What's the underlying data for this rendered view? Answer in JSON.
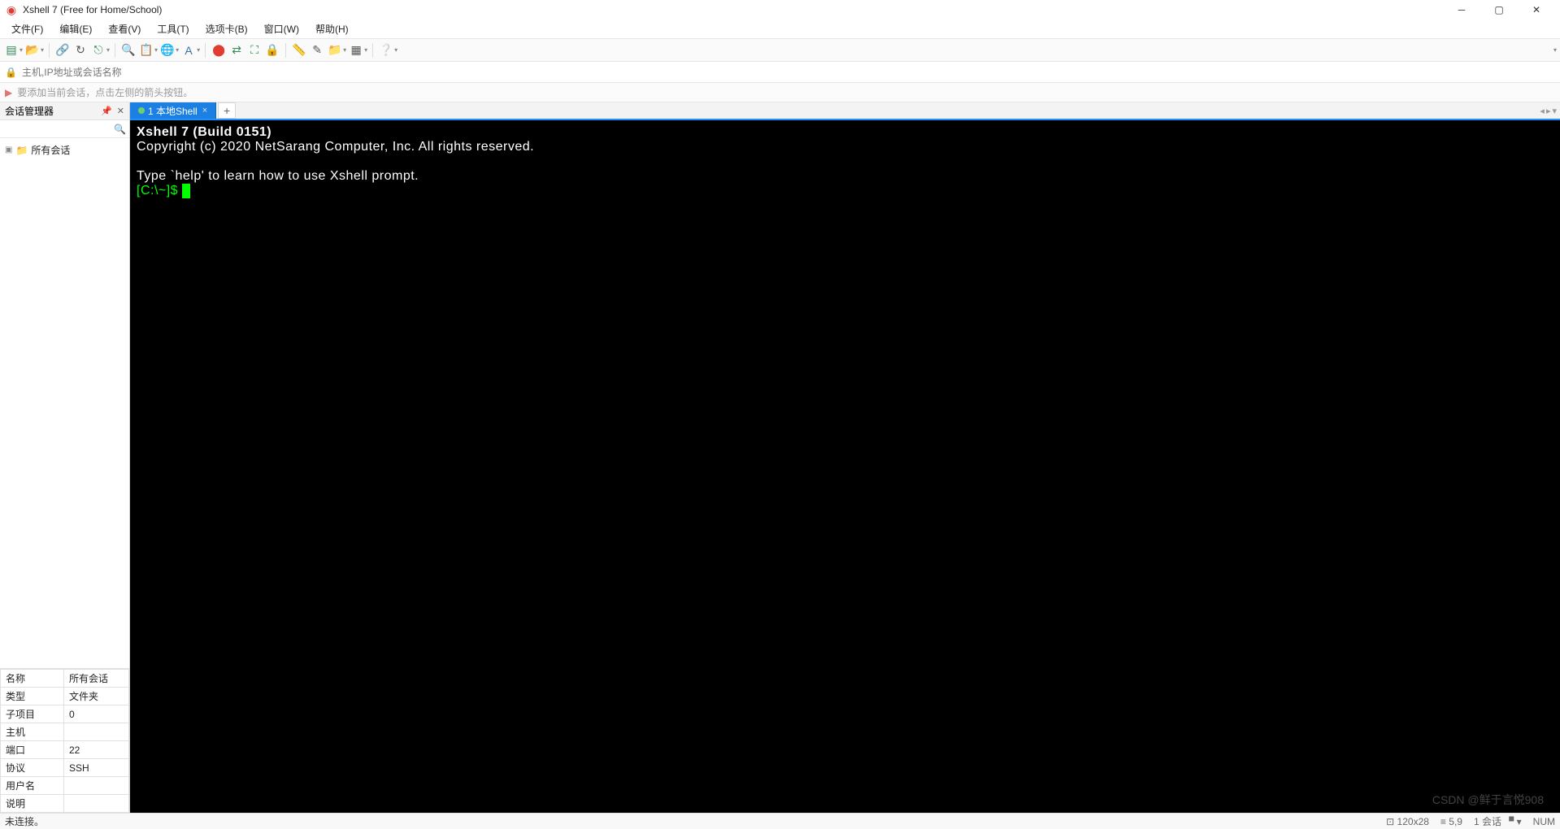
{
  "window": {
    "title": "Xshell 7 (Free for Home/School)"
  },
  "menu": {
    "items": [
      "文件(F)",
      "编辑(E)",
      "查看(V)",
      "工具(T)",
      "选项卡(B)",
      "窗口(W)",
      "帮助(H)"
    ]
  },
  "addressbar": {
    "placeholder": "主机,IP地址或会话名称"
  },
  "hint": {
    "text": "要添加当前会话，点击左侧的箭头按钮。"
  },
  "sidebar": {
    "title": "会话管理器",
    "tree_root": "所有会话",
    "props": [
      {
        "k": "名称",
        "v": "所有会话"
      },
      {
        "k": "类型",
        "v": "文件夹"
      },
      {
        "k": "子项目",
        "v": "0"
      },
      {
        "k": "主机",
        "v": ""
      },
      {
        "k": "端口",
        "v": "22"
      },
      {
        "k": "协议",
        "v": "SSH"
      },
      {
        "k": "用户名",
        "v": ""
      },
      {
        "k": "说明",
        "v": ""
      }
    ]
  },
  "tab": {
    "label": "1 本地Shell"
  },
  "terminal": {
    "line1": "Xshell 7 (Build 0151)",
    "line2": "Copyright (c) 2020 NetSarang Computer, Inc. All rights reserved.",
    "line3": "Type `help' to learn how to use Xshell prompt.",
    "prompt": "[C:\\~]$ "
  },
  "status": {
    "left": "未连接。",
    "size": "120x28",
    "cursor": "5,9",
    "sessions": "1 会话",
    "caps": "NUM"
  },
  "watermark": "CSDN @鲜于言悦908"
}
